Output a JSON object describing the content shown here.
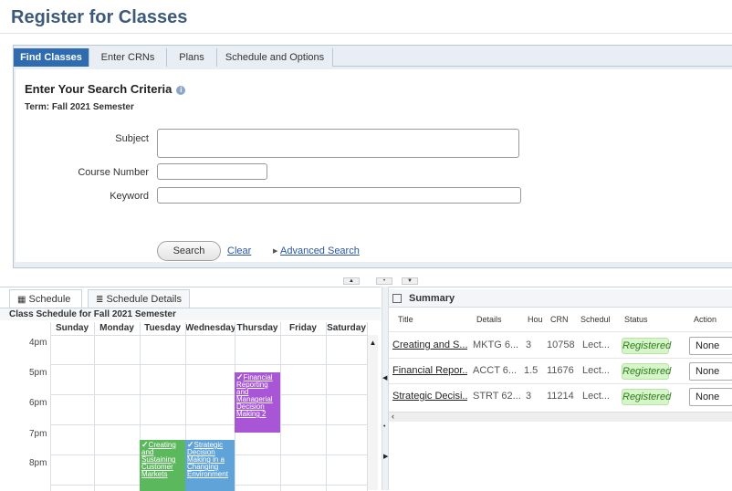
{
  "page": {
    "title": "Register for Classes"
  },
  "tabs": [
    {
      "label": "Find Classes",
      "active": true
    },
    {
      "label": "Enter CRNs",
      "active": false
    },
    {
      "label": "Plans",
      "active": false
    },
    {
      "label": "Schedule and Options",
      "active": false
    }
  ],
  "search": {
    "heading": "Enter Your Search Criteria",
    "term": "Term: Fall 2021 Semester",
    "subject_label": "Subject",
    "course_number_label": "Course Number",
    "keyword_label": "Keyword",
    "subject_value": "",
    "course_number_value": "",
    "keyword_value": "",
    "search_button": "Search",
    "clear_link": "Clear",
    "advanced_link": "Advanced Search"
  },
  "schedule_tabs": {
    "schedule": "Schedule",
    "details": "Schedule Details"
  },
  "schedule": {
    "caption": "Class Schedule for Fall 2021 Semester",
    "days": [
      "Sunday",
      "Monday",
      "Tuesday",
      "Wednesday",
      "Thursday",
      "Friday",
      "Saturday"
    ],
    "hours": [
      "4pm",
      "5pm",
      "6pm",
      "7pm",
      "8pm"
    ],
    "events": [
      {
        "title": "Financial Reporting and Managerial Decision Making 2",
        "day": "Thursday",
        "color": "#a855d6"
      },
      {
        "title": "Creating and Sustaining Customer Markets",
        "day": "Tuesday",
        "color": "#5cb85c"
      },
      {
        "title": "Strategic Decision Making in a Changing Environment",
        "day": "Wednesday",
        "color": "#5fa3d9"
      }
    ]
  },
  "summary": {
    "title": "Summary",
    "columns": [
      "Title",
      "Details",
      "Hou",
      "CRN",
      "Schedul",
      "Status",
      "Action"
    ],
    "rows": [
      {
        "title": "Creating and S...",
        "details": "MKTG 6...",
        "hours": "3",
        "crn": "10758",
        "schedule": "Lect...",
        "status": "Registered",
        "action": "None"
      },
      {
        "title": "Financial Repor...",
        "details": "ACCT 6...",
        "hours": "1.5",
        "crn": "11676",
        "schedule": "Lect...",
        "status": "Registered",
        "action": "None"
      },
      {
        "title": "Strategic Decisi...",
        "details": "STRT 62...",
        "hours": "3",
        "crn": "11214",
        "schedule": "Lect...",
        "status": "Registered",
        "action": "None"
      }
    ]
  }
}
